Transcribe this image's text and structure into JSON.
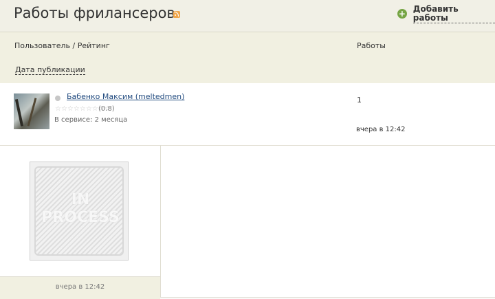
{
  "page": {
    "title": "Работы фрилансеров",
    "add_label": "Добавить работы"
  },
  "columns": {
    "user_rating": "Пользователь / Рейтинг",
    "works": "Работы",
    "publication_date": "Дата публикации"
  },
  "row": {
    "user_name": "Бабенко Максим (meltedmen)",
    "stars": "☆☆☆☆☆☆☆☆☆",
    "rating": "(0.8)",
    "service": "В сервисе: 2 месяца",
    "works_count": "1",
    "published": "вчера в 12:42"
  },
  "card": {
    "image_text_1": "IN",
    "image_text_2": "PROCESS",
    "time": "вчера в 12:42"
  },
  "colors": {
    "header_bg": "#f1f0e1",
    "link": "#234c80",
    "accent_add": "#76a544",
    "rss": "#f0a64a"
  },
  "icons": {
    "rss": "rss-icon",
    "add": "plus-circle-icon",
    "status": "status-dot-icon",
    "stars": "star-outline-icon"
  }
}
